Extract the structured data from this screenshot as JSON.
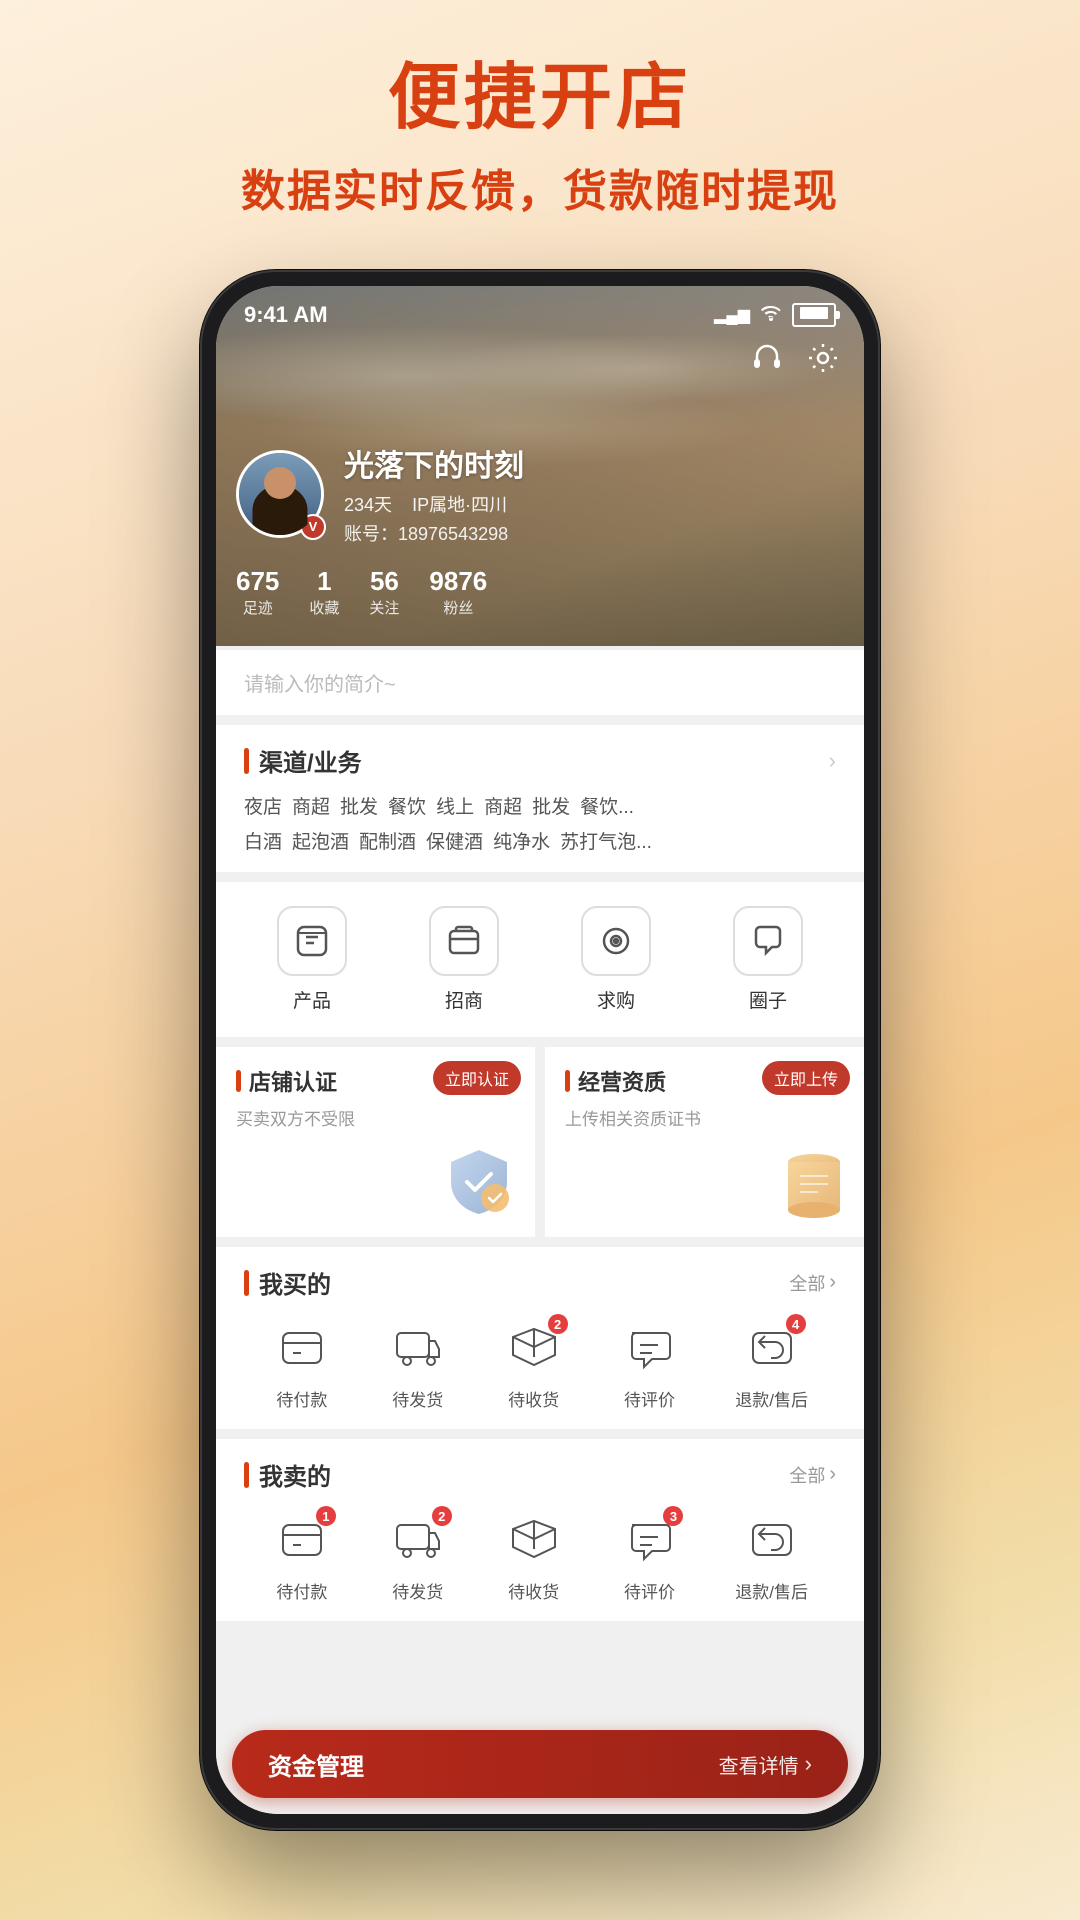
{
  "page": {
    "background": "linear-gradient(160deg, #f9e8d0, #f5d5b0, #f0c890, #eeddb0)",
    "title_main": "便捷开店",
    "title_sub": "数据实时反馈，货款随时提现"
  },
  "status_bar": {
    "time": "9:41 AM",
    "signal": "▂▄▆",
    "wifi": "WiFi",
    "battery": "🔋"
  },
  "profile": {
    "name": "光落下的时刻",
    "days": "234天",
    "ip": "IP属地·四川",
    "account_label": "账号：",
    "account": "18976543298",
    "stats": [
      {
        "num": "675",
        "label": "足迹"
      },
      {
        "num": "1",
        "label": "收藏"
      },
      {
        "num": "56",
        "label": "关注"
      },
      {
        "num": "9876",
        "label": "粉丝"
      }
    ],
    "bio_placeholder": "请输入你的简介~"
  },
  "channel": {
    "title": "渠道/业务",
    "tags_row1": [
      "夜店",
      "商超",
      "批发",
      "餐饮",
      "线上",
      "商超",
      "批发",
      "餐饮..."
    ],
    "tags_row2": [
      "白酒",
      "起泡酒",
      "配制酒",
      "保健酒",
      "纯净水",
      "苏打气泡..."
    ]
  },
  "quick_icons": [
    {
      "icon": "🛍",
      "label": "产品"
    },
    {
      "icon": "📦",
      "label": "招商"
    },
    {
      "icon": "🔍",
      "label": "求购"
    },
    {
      "icon": "💬",
      "label": "圈子"
    }
  ],
  "certification": {
    "store": {
      "title": "店铺认证",
      "badge": "立即认证",
      "desc": "买卖双方不受限",
      "icon": "🏅"
    },
    "business": {
      "title": "经营资质",
      "badge": "立即上传",
      "desc": "上传相关资质证书",
      "icon": "📜"
    }
  },
  "my_purchase": {
    "title": "我买的",
    "view_all": "全部",
    "items": [
      {
        "icon": "💳",
        "label": "待付款",
        "badge": null
      },
      {
        "icon": "📤",
        "label": "待发货",
        "badge": null
      },
      {
        "icon": "🚚",
        "label": "待收货",
        "badge": "2"
      },
      {
        "icon": "💬",
        "label": "待评价",
        "badge": null
      },
      {
        "icon": "↩",
        "label": "退款/售后",
        "badge": "4"
      }
    ]
  },
  "my_sales": {
    "title": "我卖的",
    "view_all": "全部",
    "items": [
      {
        "icon": "💳",
        "label": "待付款",
        "badge": "1"
      },
      {
        "icon": "📤",
        "label": "待发货",
        "badge": "2"
      },
      {
        "icon": "🚚",
        "label": "待收货",
        "badge": null
      },
      {
        "icon": "💬",
        "label": "待评价",
        "badge": "3"
      },
      {
        "icon": "↩",
        "label": "退款/售后",
        "badge": null
      }
    ]
  },
  "bottom_bar": {
    "left": "资金管理",
    "right": "查看详情"
  }
}
